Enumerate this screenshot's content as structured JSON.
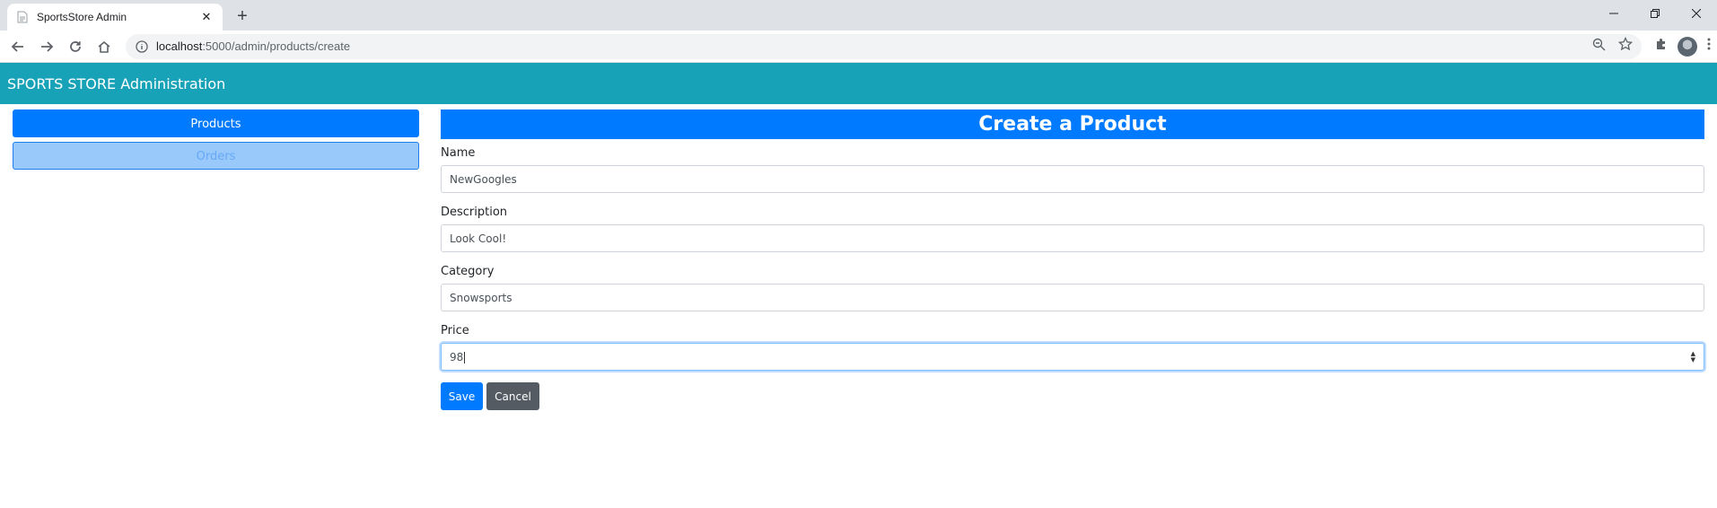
{
  "browser": {
    "tab_title": "SportsStore Admin",
    "tab_close": "✕",
    "new_tab": "+",
    "url_host": "localhost",
    "url_path": ":5000/admin/products/create"
  },
  "app": {
    "title": "SPORTS STORE Administration"
  },
  "sidebar": {
    "items": [
      {
        "label": "Products",
        "active": true
      },
      {
        "label": "Orders",
        "active": false
      }
    ]
  },
  "form": {
    "heading": "Create a Product",
    "fields": [
      {
        "label": "Name",
        "value": "NewGoogles"
      },
      {
        "label": "Description",
        "value": "Look Cool!"
      },
      {
        "label": "Category",
        "value": "Snowsports"
      },
      {
        "label": "Price",
        "value": "98"
      }
    ],
    "save_label": "Save",
    "cancel_label": "Cancel"
  },
  "colors": {
    "header": "#17a2b8",
    "primary": "#007bff",
    "secondary": "#545b62"
  }
}
